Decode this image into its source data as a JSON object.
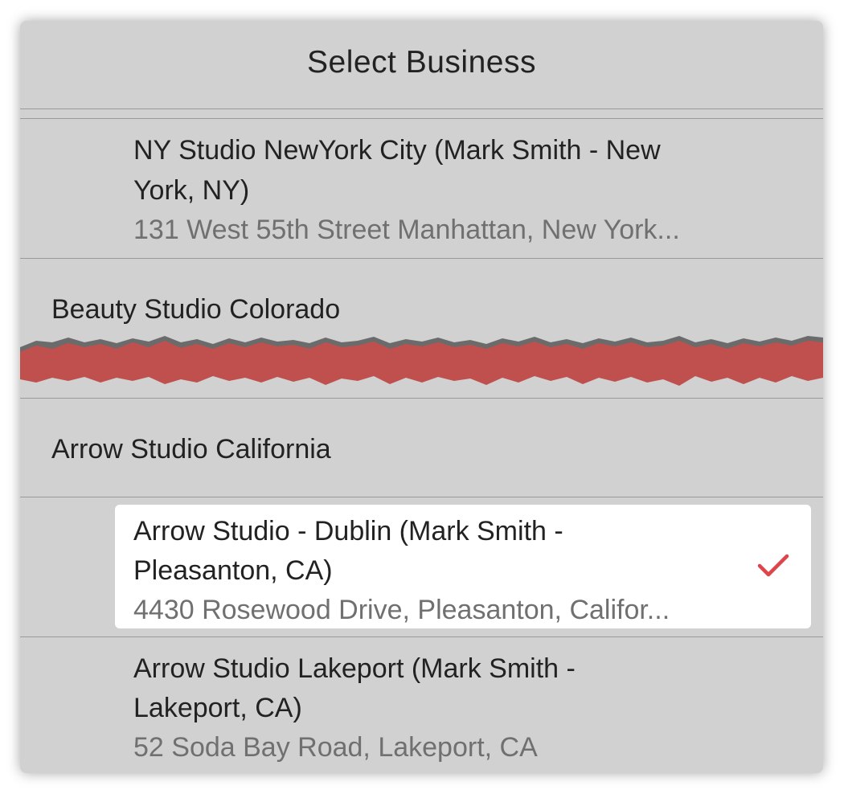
{
  "dialog": {
    "title": "Select Business"
  },
  "businesses": [
    {
      "title_line1": "NY Studio NewYork City (Mark Smith - New",
      "title_line2": "York, NY)",
      "address": "131 West 55th Street Manhattan, New York..."
    },
    {
      "group_label": "Beauty Studio Colorado"
    },
    {
      "group_label": "Arrow Studio California"
    },
    {
      "title_line1": "Arrow Studio - Dublin (Mark Smith -",
      "title_line2": "Pleasanton, CA)",
      "address": "4430 Rosewood Drive, Pleasanton, Califor...",
      "selected": true
    },
    {
      "title_line1": "Arrow Studio Lakeport (Mark Smith -",
      "title_line2": "Lakeport, CA)",
      "address": "52 Soda Bay Road, Lakeport, CA"
    }
  ],
  "colors": {
    "panel_bg": "#d1d1d1",
    "selected_bg": "#ffffff",
    "accent_check": "#e0444b",
    "redaction": "#c0504d"
  },
  "icons": {
    "selected_indicator": "checkmark-icon"
  }
}
